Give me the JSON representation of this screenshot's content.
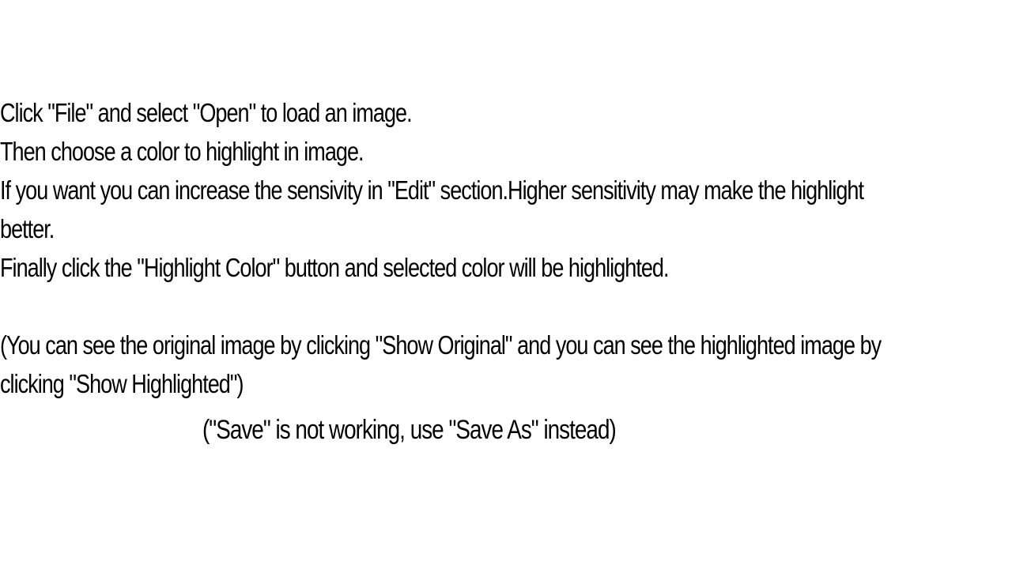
{
  "instructions": {
    "line1": "Click \"File\" and select \"Open\" to load an image.",
    "line2": "Then choose a color to highlight in image.",
    "line3a": "If you want you can increase the sensivity in \"Edit\" section.Higher sensitivity may make the highlight",
    "line3b": "better.",
    "line4": "Finally click the \"Highlight Color\" button and selected color will be highlighted.",
    "line5a": "(You can see the original image by clicking \"Show Original\" and you can see the highlighted image by",
    "line5b": "clicking \"Show Highlighted\")"
  },
  "note": {
    "text": "(\"Save\" is not working, use \"Save As\" instead)"
  }
}
